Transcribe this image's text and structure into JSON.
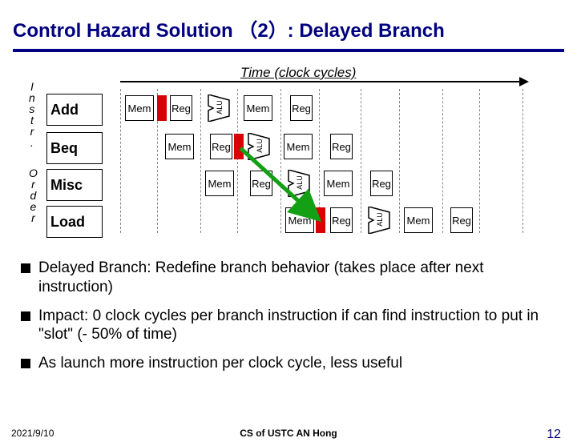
{
  "title": "Control Hazard Solution （2）: Delayed Branch",
  "time_label": "Time (clock cycles)",
  "vert_labels": {
    "instr": [
      "I",
      "n",
      "s",
      "t",
      "r",
      "."
    ],
    "order": [
      "O",
      "r",
      "d",
      "e",
      "r"
    ]
  },
  "instructions": [
    "Add",
    "Beq",
    "Misc",
    "Load"
  ],
  "stage_labels": {
    "mem": "Mem",
    "reg": "Reg",
    "alu": "ALU"
  },
  "bullets": [
    "Delayed Branch: Redefine branch behavior (takes place after next instruction)",
    "Impact: 0 clock cycles per branch instruction if can find instruction to put in \"slot\" (- 50% of time)",
    "As launch more instruction per clock cycle, less useful"
  ],
  "footer": {
    "date": "2021/9/10",
    "center": "CS of USTC AN Hong",
    "page": "12"
  }
}
